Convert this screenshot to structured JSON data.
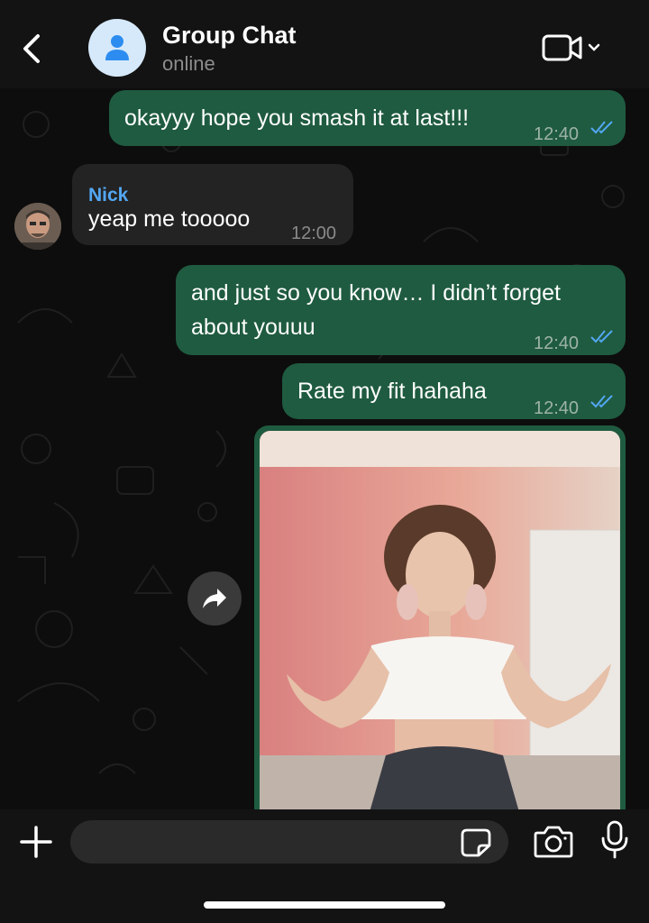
{
  "header": {
    "title": "Group Chat",
    "subtitle": "online",
    "avatar_icon": "person-icon",
    "back_icon": "chevron-left-icon",
    "video_icon": "video-call-icon"
  },
  "messages": [
    {
      "direction": "outgoing",
      "text": "okayyy hope you smash it at last!!!",
      "time": "12:40",
      "status": "read"
    },
    {
      "direction": "incoming",
      "sender": "Nick",
      "text": "yeap me tooooo",
      "time": "12:00"
    },
    {
      "direction": "outgoing",
      "text_line1": "and just so you know… I didn’t forget",
      "text_line2": "about youuu",
      "time": "12:40",
      "status": "read"
    },
    {
      "direction": "outgoing",
      "text": "Rate my fit hahaha",
      "time": "12:40",
      "status": "read"
    },
    {
      "direction": "outgoing",
      "type": "image",
      "image_subject": "photo of a person in a white crop top"
    }
  ],
  "composer": {
    "placeholder": "",
    "plus_icon": "plus-icon",
    "sticker_icon": "sticker-icon",
    "camera_icon": "camera-icon",
    "mic_icon": "microphone-icon"
  },
  "colors": {
    "outgoing_bubble": "#1f5b40",
    "incoming_bubble": "#232323",
    "sender_name": "#53a7f3",
    "read_ticks": "#53a7f3",
    "header_bg": "#131313"
  }
}
